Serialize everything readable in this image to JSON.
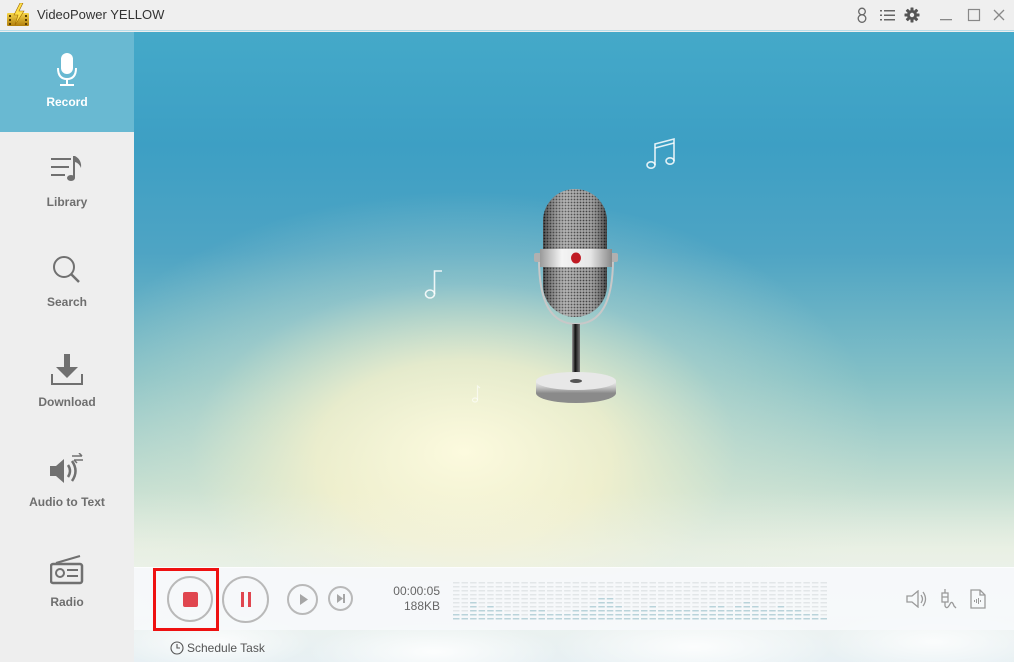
{
  "app": {
    "title": "VideoPower YELLOW",
    "logo_icon": "film-lightning-logo"
  },
  "titlebar": {
    "icons": [
      "user-icon",
      "menu-list-icon",
      "gear-icon"
    ],
    "window_controls": [
      "minimize-icon",
      "maximize-icon",
      "close-icon"
    ]
  },
  "sidebar": {
    "items": [
      {
        "label": "Record",
        "icon": "microphone-icon",
        "active": true
      },
      {
        "label": "Library",
        "icon": "music-list-icon",
        "active": false
      },
      {
        "label": "Search",
        "icon": "search-icon",
        "active": false
      },
      {
        "label": "Download",
        "icon": "download-icon",
        "active": false
      },
      {
        "label": "Audio to Text",
        "icon": "speaker-convert-icon",
        "active": false
      },
      {
        "label": "Radio",
        "icon": "radio-icon",
        "active": false
      }
    ]
  },
  "recorder": {
    "elapsed": "00:00:05",
    "file_size": "188KB",
    "buttons": [
      "stop",
      "pause",
      "play",
      "skip-next"
    ],
    "right_icons": [
      "volume-icon",
      "audio-jack-icon",
      "audio-file-icon"
    ],
    "level_meter": [
      2,
      2,
      5,
      3,
      4,
      3,
      2,
      2,
      1,
      3,
      3,
      2,
      2,
      2,
      3,
      3,
      4,
      6,
      6,
      4,
      3,
      3,
      3,
      4,
      3,
      3,
      3,
      3,
      3,
      3,
      4,
      4,
      3,
      4,
      5,
      4,
      3,
      3,
      4,
      3,
      3,
      2,
      2,
      1
    ]
  },
  "schedule": {
    "label": "Schedule Task",
    "icon": "clock-icon"
  },
  "colors": {
    "accent": "#69b9d2",
    "record_red": "#e0464f",
    "highlight_red": "#ee1111"
  }
}
